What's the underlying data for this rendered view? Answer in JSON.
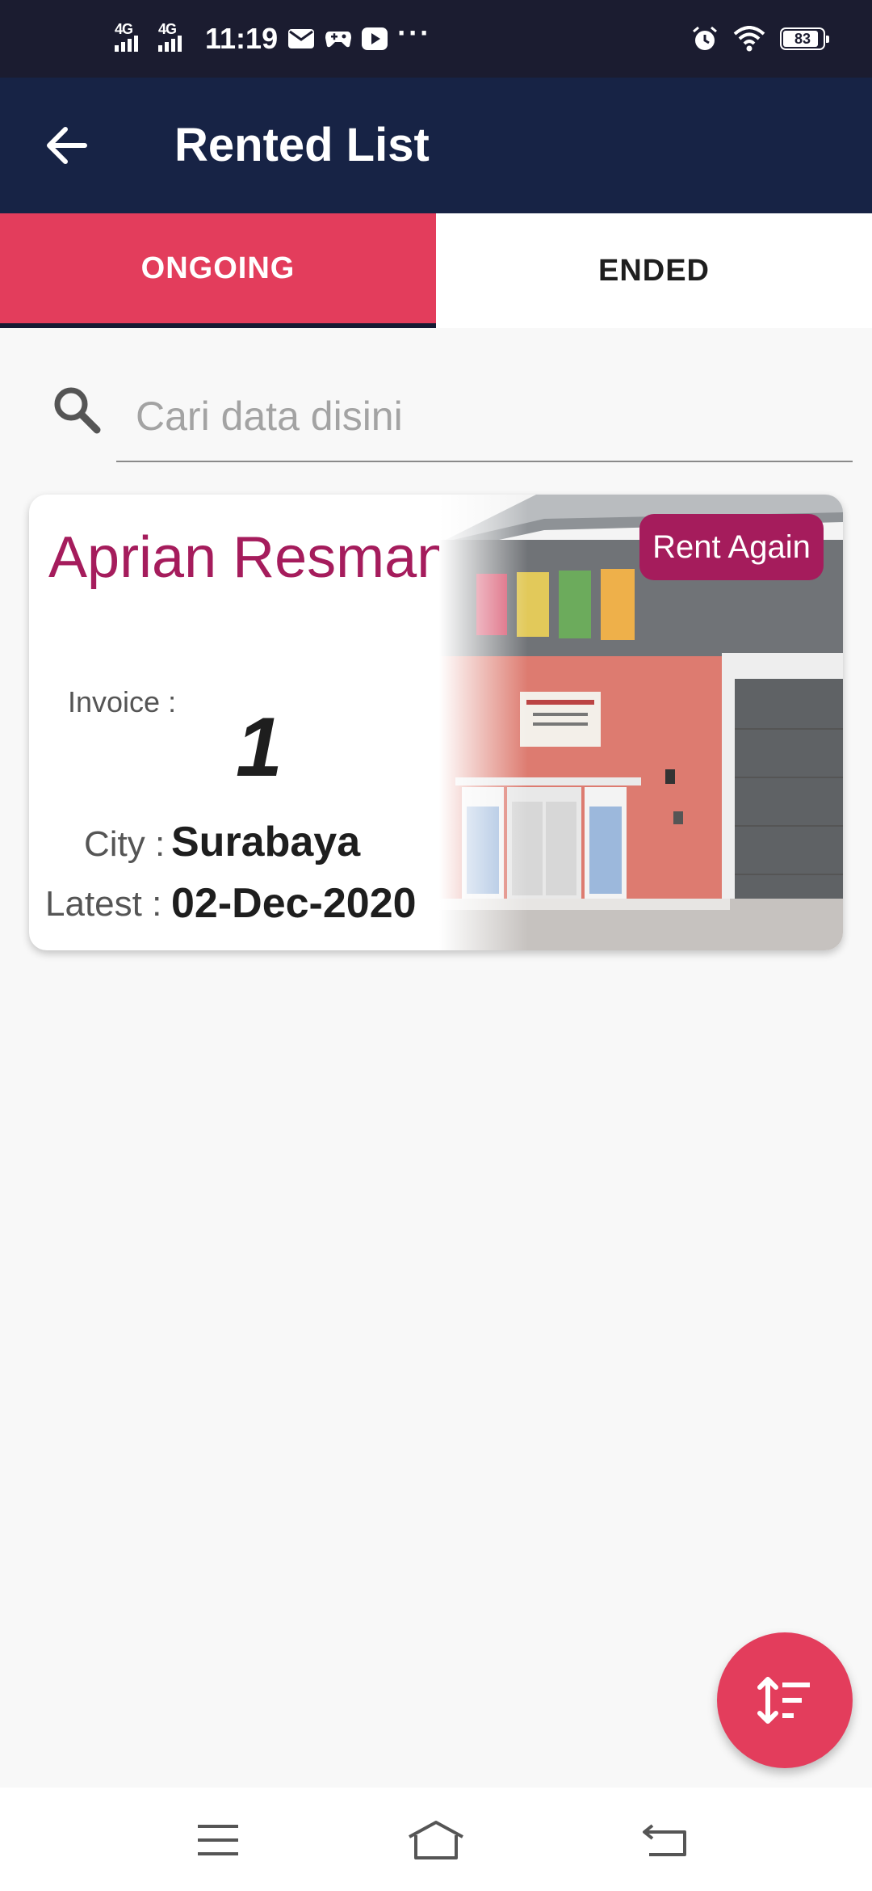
{
  "status_bar": {
    "network_1": "4G",
    "network_2": "4G",
    "time": "11:19",
    "battery": "83",
    "battery_level": 0.83,
    "icons": [
      "mail-icon",
      "game-controller-icon",
      "youtube-icon",
      "more-dots-icon",
      "alarm-icon",
      "wifi-icon",
      "battery-icon"
    ],
    "more": "···"
  },
  "app_bar": {
    "title": "Rented List",
    "back_icon": "arrow-left-icon"
  },
  "tabs": [
    {
      "label": "ONGOING",
      "active": true
    },
    {
      "label": "ENDED",
      "active": false
    }
  ],
  "search": {
    "placeholder": "Cari data disini",
    "value": ""
  },
  "rentals": [
    {
      "name": "Aprian Resman",
      "invoice_label": "Invoice :",
      "invoice_value": "1",
      "city_label": "City :",
      "city_value": "Surabaya",
      "latest_label": "Latest :",
      "latest_value": "02-Dec-2020",
      "action_label": "Rent Again"
    }
  ],
  "fab": {
    "icon": "sort-icon"
  },
  "nav_bar": {
    "icons": [
      "menu-icon",
      "home-icon",
      "back-icon"
    ]
  },
  "colors": {
    "status_bar": "#1b1c30",
    "app_bar": "#172345",
    "accent": "#e33d5c",
    "name": "#a51c5c",
    "background": "#f8f8f8"
  }
}
